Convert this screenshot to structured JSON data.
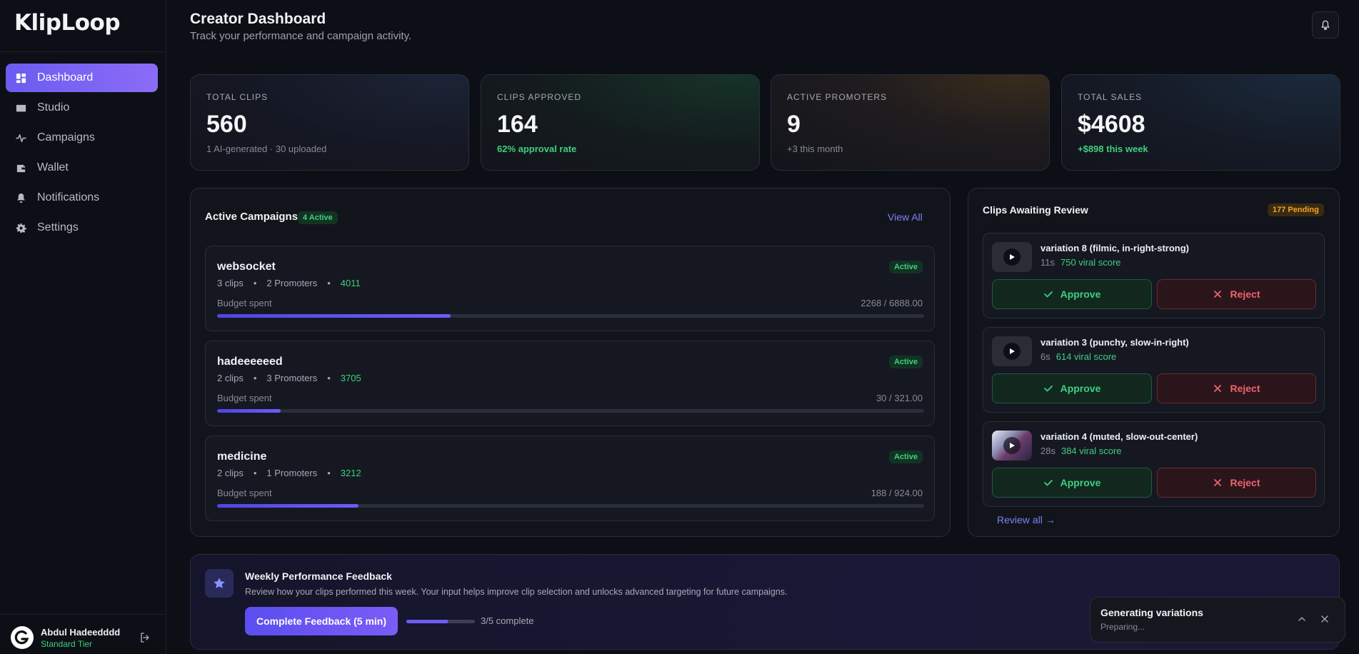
{
  "app": {
    "logo": "KlipLoop"
  },
  "sidebar": {
    "items": [
      {
        "label": "Dashboard",
        "icon": "dashboard-icon"
      },
      {
        "label": "Studio",
        "icon": "film-icon"
      },
      {
        "label": "Campaigns",
        "icon": "activity-icon"
      },
      {
        "label": "Wallet",
        "icon": "wallet-icon"
      },
      {
        "label": "Notifications",
        "icon": "bell-icon"
      },
      {
        "label": "Settings",
        "icon": "gear-icon"
      }
    ],
    "user": {
      "name": "Abdul Hadeedddd",
      "tier": "Standard Tier"
    }
  },
  "header": {
    "title": "Creator Dashboard",
    "subtitle": "Track your performance and campaign activity."
  },
  "stats": [
    {
      "label": "TOTAL CLIPS",
      "value": "560",
      "sub": "1 AI-generated · 30 uploaded"
    },
    {
      "label": "CLIPS APPROVED",
      "value": "164",
      "sub": "62% approval rate"
    },
    {
      "label": "ACTIVE PROMOTERS",
      "value": "9",
      "sub": "+3 this month"
    },
    {
      "label": "TOTAL SALES",
      "value": "$4608",
      "sub": "+$898 this week"
    }
  ],
  "campaigns": {
    "title": "Active Campaigns",
    "badge": "4 Active",
    "view_all": "View All",
    "items": [
      {
        "name": "websocket",
        "clips": "3 clips",
        "promoters": "2 Promoters",
        "number": "4011",
        "status": "Active",
        "budget_label": "Budget spent",
        "budget": "2268 / 6888.00",
        "progress": 0.33
      },
      {
        "name": "hadeeeeeed",
        "clips": "2 clips",
        "promoters": "3 Promoters",
        "number": "3705",
        "status": "Active",
        "budget_label": "Budget spent",
        "budget": "30 / 321.00",
        "progress": 0.09
      },
      {
        "name": "medicine",
        "clips": "2 clips",
        "promoters": "1 Promoters",
        "number": "3212",
        "status": "Active",
        "budget_label": "Budget spent",
        "budget": "188 / 924.00",
        "progress": 0.2
      }
    ]
  },
  "review": {
    "title": "Clips Awaiting Review",
    "badge": "177 Pending",
    "approve": "Approve",
    "reject": "Reject",
    "review_all": "Review all →",
    "clips": [
      {
        "title": "variation 8 (filmic, in-right-strong)",
        "duration": "11s",
        "score": "750 viral score"
      },
      {
        "title": "variation 3 (punchy, slow-in-right)",
        "duration": "6s",
        "score": "614 viral score"
      },
      {
        "title": "variation 4 (muted, slow-out-center)",
        "duration": "28s",
        "score": "384 viral score"
      }
    ]
  },
  "feedback": {
    "title": "Weekly Performance Feedback",
    "text": "Review how your clips performed this week. Your input helps improve clip selection and unlocks advanced targeting for future campaigns.",
    "button": "Complete Feedback (5 min)",
    "progress": 0.6,
    "count": "3/5 complete"
  },
  "toast": {
    "title": "Generating variations",
    "status": "Preparing..."
  },
  "colors": {
    "accent": "#6d5cf6",
    "success": "#3fcf7f",
    "danger": "#f0626e",
    "warning": "#f5a524"
  }
}
